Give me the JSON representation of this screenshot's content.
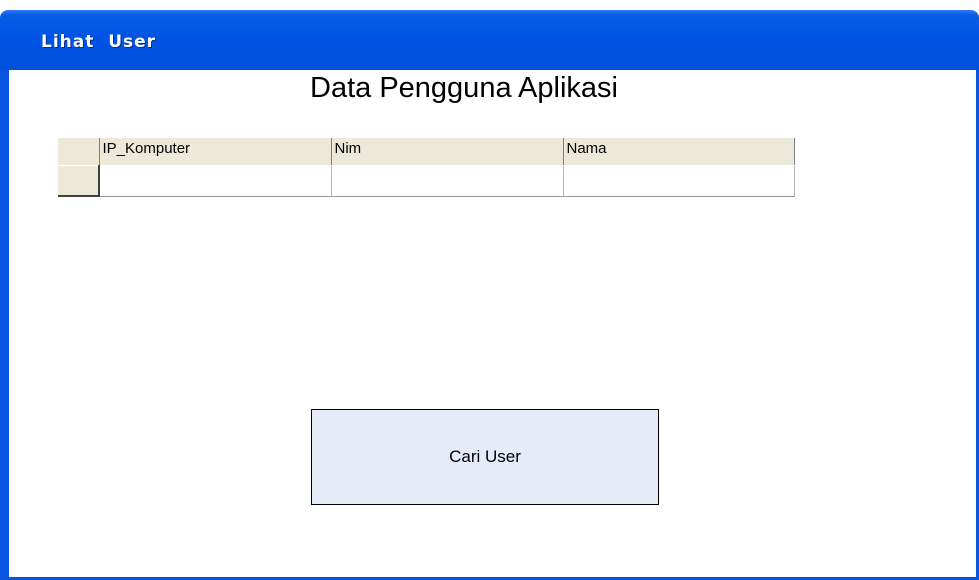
{
  "window": {
    "title": "Lihat  User"
  },
  "main": {
    "heading": "Data Pengguna Aplikasi",
    "table": {
      "columns": [
        "IP_Komputer",
        "Nim",
        "Nama"
      ],
      "rows": [
        [
          "",
          "",
          ""
        ]
      ]
    },
    "search_button_label": "Cari User"
  },
  "colors": {
    "titlebar": "#0055e5",
    "button_bg": "#e5ebf7",
    "header_bg": "#ece9d8"
  }
}
